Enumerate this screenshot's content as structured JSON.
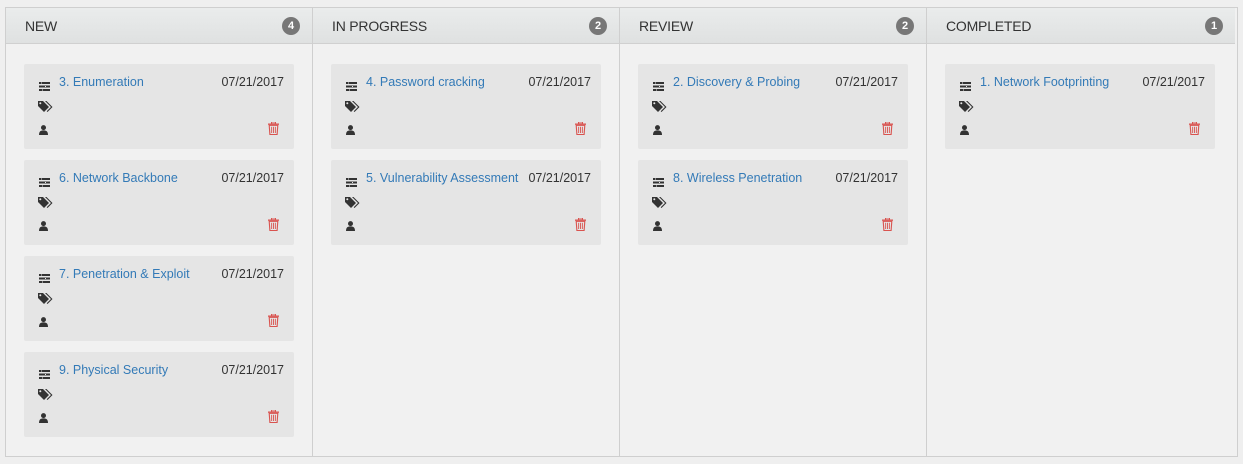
{
  "columns": [
    {
      "title": "NEW",
      "count": "4",
      "cards": [
        {
          "title": "3. Enumeration",
          "date": "07/21/2017"
        },
        {
          "title": "6. Network Backbone",
          "date": "07/21/2017"
        },
        {
          "title": "7. Penetration & Exploit",
          "date": "07/21/2017"
        },
        {
          "title": "9. Physical Security",
          "date": "07/21/2017"
        }
      ]
    },
    {
      "title": "IN PROGRESS",
      "count": "2",
      "cards": [
        {
          "title": "4. Password cracking",
          "date": "07/21/2017"
        },
        {
          "title": "5. Vulnerability Assessment",
          "date": "07/21/2017"
        }
      ]
    },
    {
      "title": "REVIEW",
      "count": "2",
      "cards": [
        {
          "title": "2. Discovery & Probing",
          "date": "07/21/2017"
        },
        {
          "title": "8. Wireless Penetration",
          "date": "07/21/2017"
        }
      ]
    },
    {
      "title": "COMPLETED",
      "count": "1",
      "cards": [
        {
          "title": "1. Network Footprinting",
          "date": "07/21/2017"
        }
      ]
    }
  ],
  "icons": {
    "task": "tasks-icon",
    "tags": "tags-icon",
    "user": "user-icon",
    "delete": "trash-icon"
  },
  "colors": {
    "link": "#337ab7",
    "delete": "#d9534f",
    "badge": "#777777",
    "card": "#e5e5e5"
  }
}
